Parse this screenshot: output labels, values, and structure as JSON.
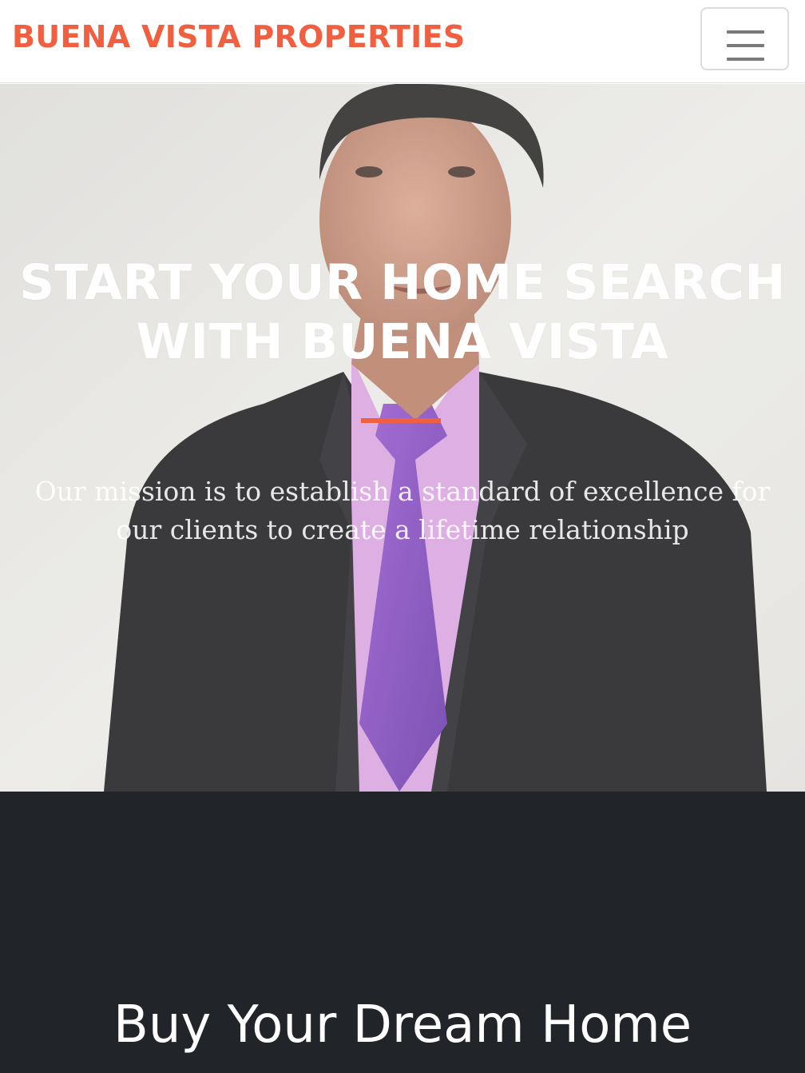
{
  "navbar": {
    "brand": "BUENA VISTA PROPERTIES",
    "menu_icon": "hamburger-menu-icon"
  },
  "hero": {
    "title": "START YOUR HOME SEARCH WITH BUENA VISTA",
    "text": "Our mission is to establish a standard of excellence for our clients to create a lifetime relationship",
    "accent_color": "#f05f40"
  },
  "services": {
    "title": "Buy Your Dream Home",
    "background_color": "#212529"
  }
}
